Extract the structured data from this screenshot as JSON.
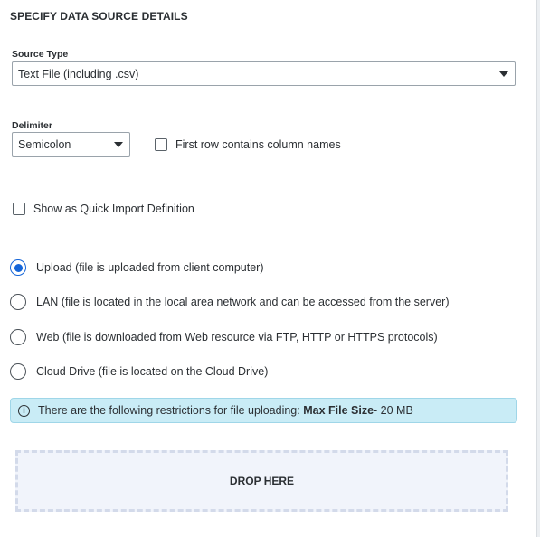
{
  "section_title": "SPECIFY DATA SOURCE DETAILS",
  "source_type": {
    "label": "Source Type",
    "value": "Text File (including .csv)"
  },
  "delimiter": {
    "label": "Delimiter",
    "value": "Semicolon"
  },
  "first_row_checkbox": {
    "label": "First row contains column names",
    "checked": false
  },
  "quick_import_checkbox": {
    "label": "Show as Quick Import Definition",
    "checked": false
  },
  "location_options": [
    {
      "label": "Upload (file is uploaded from client computer)",
      "checked": true
    },
    {
      "label": "LAN (file is located in the local area network and can be accessed from the server)",
      "checked": false
    },
    {
      "label": "Web (file is downloaded from Web resource via FTP, HTTP or HTTPS protocols)",
      "checked": false
    },
    {
      "label": "Cloud Drive (file is located on the Cloud Drive)",
      "checked": false
    }
  ],
  "info": {
    "icon": "info-icon",
    "text": "There are the following restrictions for file uploading:",
    "bold": "Max File Size",
    "suffix": " - 20 MB"
  },
  "drop_zone": {
    "label": "DROP HERE"
  },
  "colors": {
    "accent": "#1565d8",
    "info_bg": "#c9ecf6",
    "drop_bg": "#f1f4fb"
  }
}
